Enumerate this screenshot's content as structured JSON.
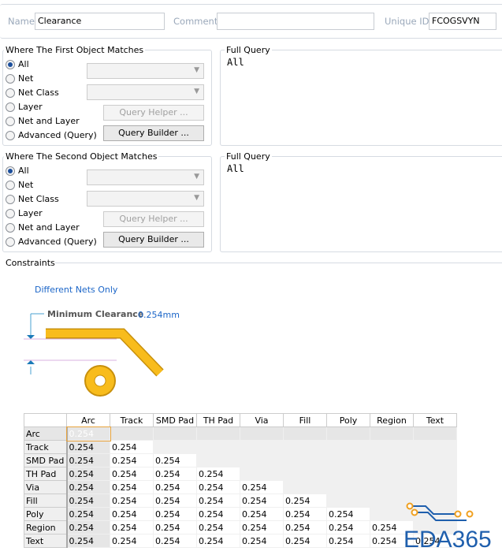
{
  "header": {
    "name_label": "Name",
    "name_value": "Clearance",
    "comment_label": "Comment",
    "comment_value": "",
    "uid_label": "Unique ID",
    "uid_value": "FCOGSVYN"
  },
  "first": {
    "title": "Where The First Object Matches",
    "options": [
      "All",
      "Net",
      "Net Class",
      "Layer",
      "Net and Layer",
      "Advanced (Query)"
    ],
    "selected": "All",
    "query_helper": "Query Helper ...",
    "query_builder": "Query Builder ...",
    "full_query_label": "Full Query",
    "full_query": "All"
  },
  "second": {
    "title": "Where The Second Object Matches",
    "options": [
      "All",
      "Net",
      "Net Class",
      "Layer",
      "Net and Layer",
      "Advanced (Query)"
    ],
    "selected": "All",
    "query_helper": "Query Helper ...",
    "query_builder": "Query Builder ...",
    "full_query_label": "Full Query",
    "full_query": "All"
  },
  "constraints": {
    "title": "Constraints",
    "net_scope": "Different Nets Only",
    "min_clearance_label": "Minimum Clearance",
    "min_clearance_value": "0.254mm"
  },
  "matrix": {
    "columns": [
      "Arc",
      "Track",
      "SMD Pad",
      "TH Pad",
      "Via",
      "Fill",
      "Poly",
      "Region",
      "Text"
    ],
    "rows": [
      "Arc",
      "Track",
      "SMD Pad",
      "TH Pad",
      "Via",
      "Fill",
      "Poly",
      "Region",
      "Text"
    ],
    "value": "0.254"
  },
  "logo": {
    "text": "EDA365",
    "colors": {
      "blue": "#1f5fad",
      "orange": "#f0a020"
    }
  }
}
